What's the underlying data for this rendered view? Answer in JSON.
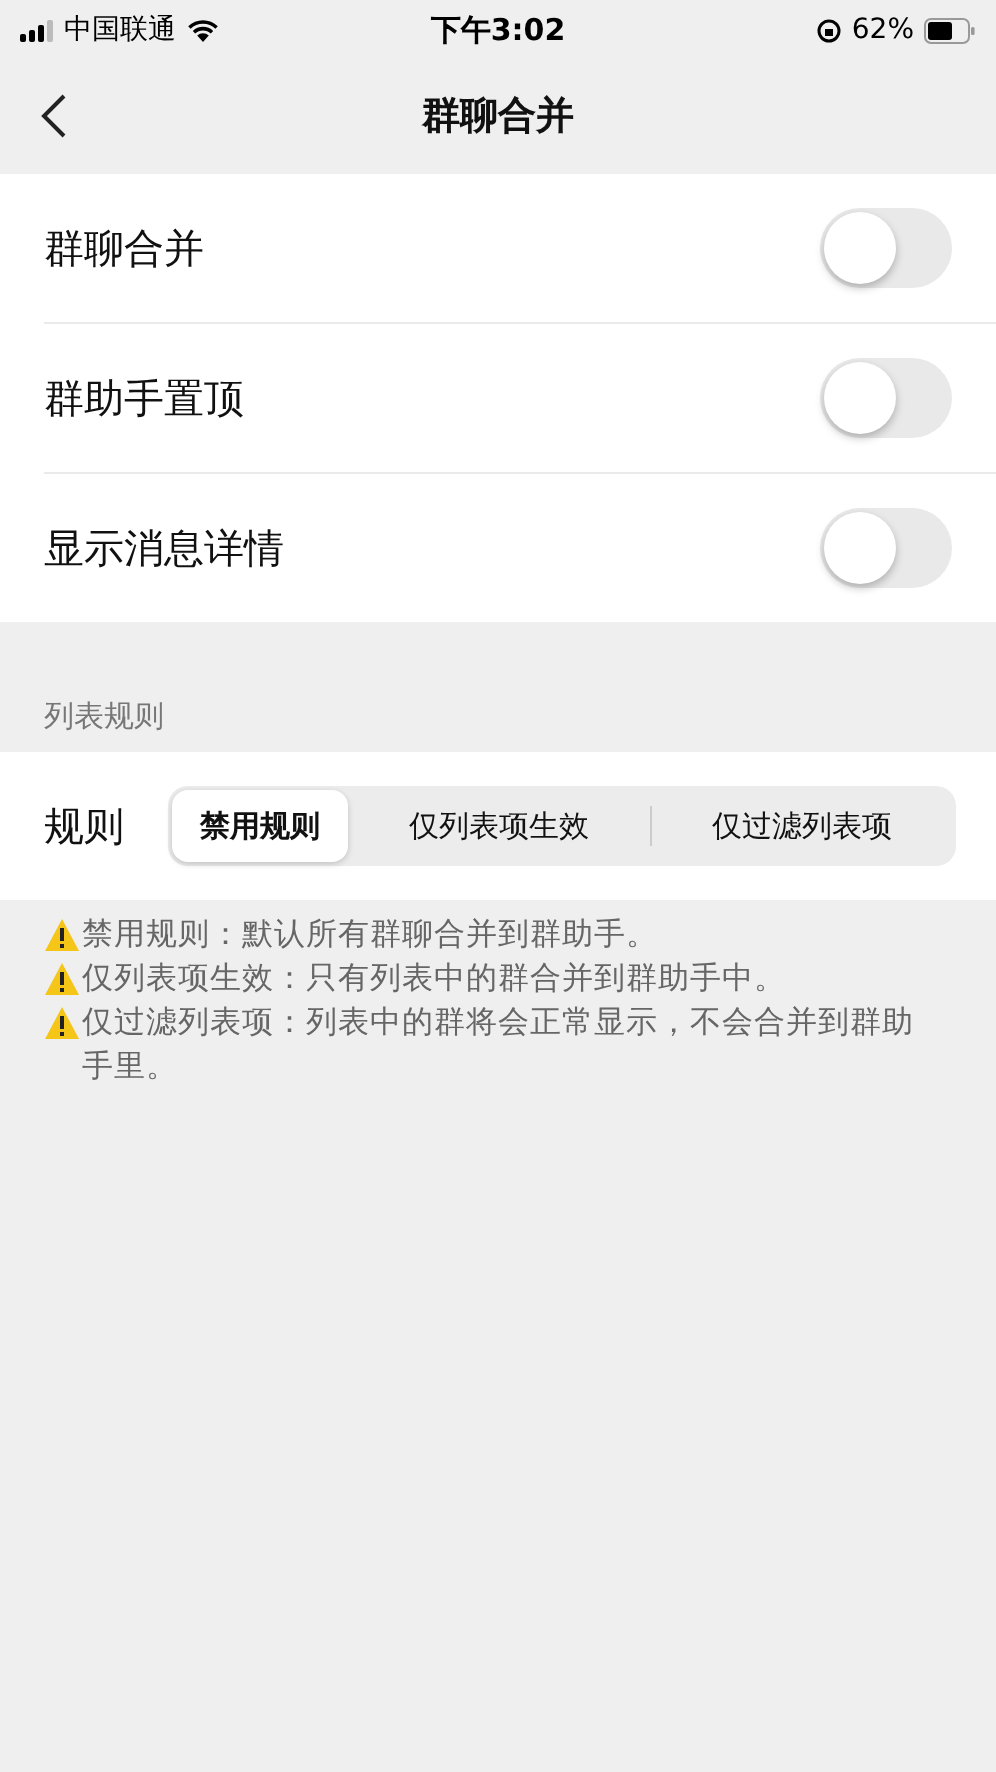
{
  "status_bar": {
    "carrier": "中国联通",
    "time": "下午3:02",
    "battery": "62%"
  },
  "nav": {
    "title": "群聊合并"
  },
  "toggles": [
    {
      "label": "群聊合并",
      "on": false
    },
    {
      "label": "群助手置顶",
      "on": false
    },
    {
      "label": "显示消息详情",
      "on": false
    }
  ],
  "section_header": "列表规则",
  "rule": {
    "label": "规则",
    "segments": [
      {
        "label": "禁用规则",
        "selected": true
      },
      {
        "label": "仅列表项生效",
        "selected": false
      },
      {
        "label": "仅过滤列表项",
        "selected": false
      }
    ]
  },
  "notes": [
    "禁用规则：默认所有群聊合并到群助手。",
    "仅列表项生效：只有列表中的群合并到群助手中。",
    "仅过滤列表项：列表中的群将会正常显示，不会合并到群助手里。"
  ]
}
